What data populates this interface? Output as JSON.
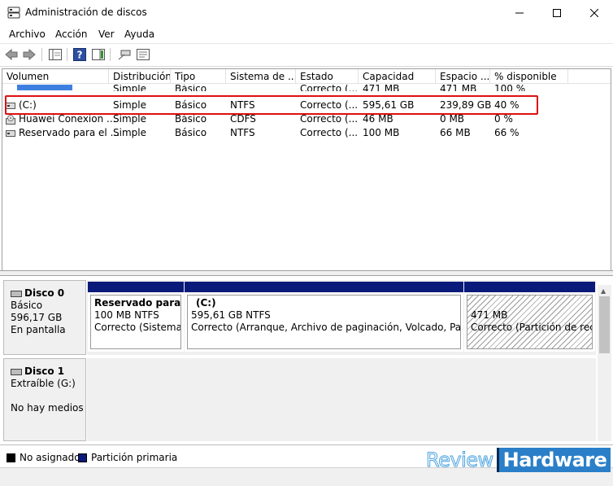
{
  "window": {
    "title": "Administración de discos"
  },
  "menu": [
    "Archivo",
    "Acción",
    "Ver",
    "Ayuda"
  ],
  "volume_table": {
    "columns": [
      "Volumen",
      "Distribución",
      "Tipo",
      "Sistema de ...",
      "Estado",
      "Capacidad",
      "Espacio ...",
      "% disponible"
    ],
    "rows": [
      {
        "volume": "",
        "layout": "Simple",
        "type": "Básico",
        "fs": "",
        "status": "Correcto (...",
        "capacity": "471 MB",
        "free": "471 MB",
        "pct": "100 %"
      },
      {
        "volume": "(C:)",
        "layout": "Simple",
        "type": "Básico",
        "fs": "NTFS",
        "status": "Correcto (...",
        "capacity": "595,61 GB",
        "free": "239,89 GB",
        "pct": "40 %"
      },
      {
        "volume": "Huawei Conexion ...",
        "layout": "Simple",
        "type": "Básico",
        "fs": "CDFS",
        "status": "Correcto (...",
        "capacity": "46 MB",
        "free": "0 MB",
        "pct": "0 %"
      },
      {
        "volume": "Reservado para el ...",
        "layout": "Simple",
        "type": "Básico",
        "fs": "NTFS",
        "status": "Correcto (...",
        "capacity": "100 MB",
        "free": "66 MB",
        "pct": "66 %"
      }
    ]
  },
  "disks": [
    {
      "name": "Disco 0",
      "type": "Básico",
      "size": "596,17 GB",
      "state": "En pantalla",
      "partitions": [
        {
          "name": "Reservado para el s",
          "size": "100 MB NTFS",
          "status": "Correcto (Sistema, A"
        },
        {
          "name": "(C:)",
          "size": "595,61 GB NTFS",
          "status": "Correcto (Arranque, Archivo de paginación, Volcado, Partición"
        },
        {
          "name": "",
          "size": "471 MB",
          "status": "Correcto (Partición de recup"
        }
      ]
    },
    {
      "name": "Disco 1",
      "type": "Extraíble (G:)",
      "size": "",
      "state": "No hay medios"
    }
  ],
  "legend": [
    {
      "label": "No asignado",
      "color": "#000000"
    },
    {
      "label": "Partición primaria",
      "color": "#0a1a7a"
    }
  ],
  "watermark": {
    "word1": "Review",
    "word2": "Hardware"
  },
  "colors": {
    "highlight": "#dd1111",
    "primary_partition": "#0a1a7a"
  }
}
